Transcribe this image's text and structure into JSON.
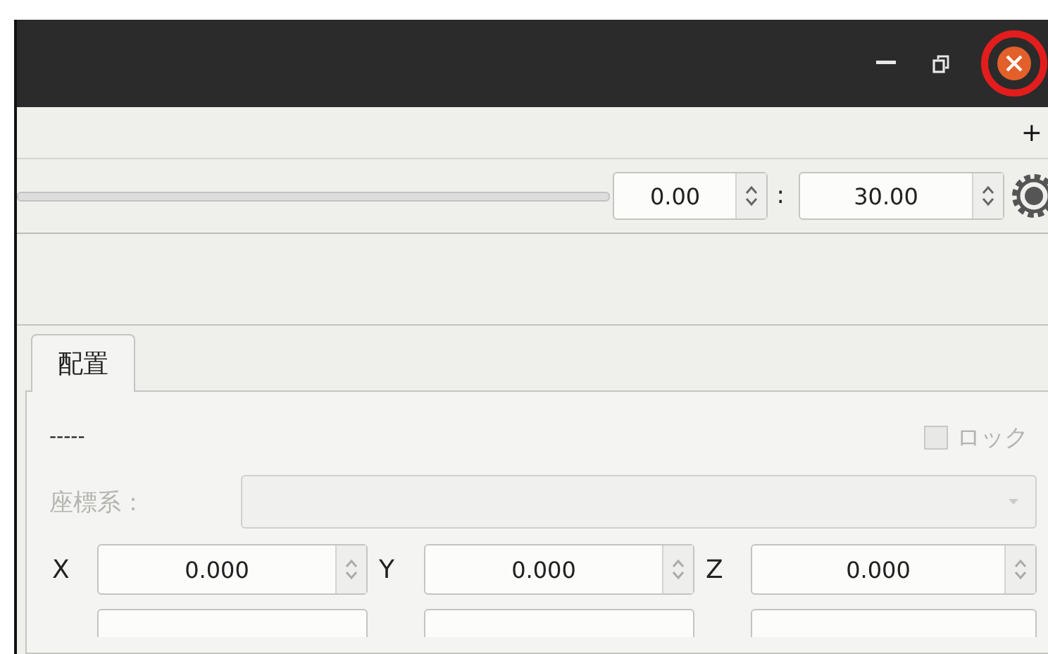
{
  "toolbar": {
    "add": "+"
  },
  "timeline": {
    "start": "0.00",
    "separator": ":",
    "end": "30.00"
  },
  "panel": {
    "tabs": [
      {
        "label": "配置",
        "selected": true
      }
    ],
    "object_name": "-----",
    "lock": {
      "label": "ロック",
      "checked": false,
      "disabled": true
    },
    "coordinate_system": {
      "label": "座標系：",
      "disabled": true
    },
    "position": [
      {
        "axis": "X",
        "value": "0.000"
      },
      {
        "axis": "Y",
        "value": "0.000"
      },
      {
        "axis": "Z",
        "value": "0.000"
      }
    ]
  }
}
